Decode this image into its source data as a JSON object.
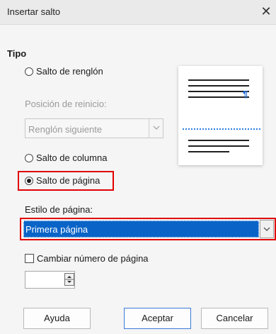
{
  "window": {
    "title": "Insertar salto",
    "close_glyph": "✕"
  },
  "section": {
    "tipo_label": "Tipo"
  },
  "options": {
    "line_break_label": "Salto de renglón",
    "restart_position_label": "Posición de reinicio:",
    "restart_value": "Renglón siguiente",
    "column_break_label": "Salto de columna",
    "page_break_label": "Salto de página",
    "selected": "page_break"
  },
  "page_style": {
    "label": "Estilo de página:",
    "value": "Primera página"
  },
  "page_number": {
    "change_label": "Cambiar número de página",
    "checked": false,
    "value": ""
  },
  "preview": {
    "pilcrow": "¶"
  },
  "buttons": {
    "help": "Ayuda",
    "ok": "Aceptar",
    "cancel": "Cancelar"
  },
  "colors": {
    "highlight": "#e00000",
    "selection": "#0a64c8",
    "pilcrow": "#1e6cd6",
    "dots": "#2a7de1"
  }
}
